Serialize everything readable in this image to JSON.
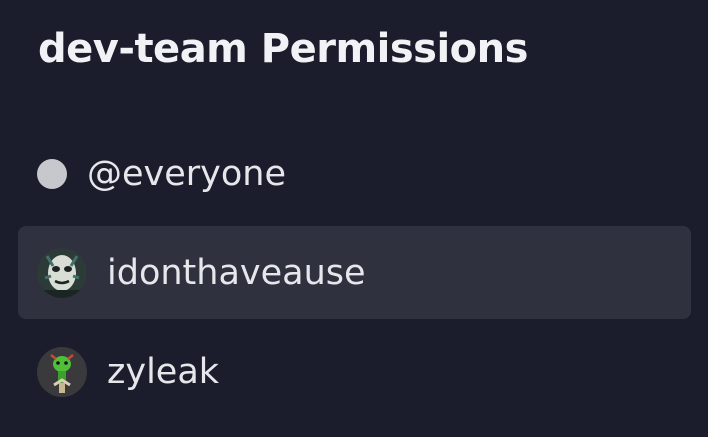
{
  "header": {
    "title": "dev-team Permissions"
  },
  "permissions": {
    "everyone": {
      "label": "@everyone"
    },
    "members": [
      {
        "name": "idonthaveause",
        "avatar": "masked-face-avatar",
        "selected": true
      },
      {
        "name": "zyleak",
        "avatar": "green-character-avatar",
        "selected": false
      }
    ]
  },
  "colors": {
    "background": "#1b1d2c",
    "selected_row": "#2f313f",
    "everyone_dot": "#c7c8cd",
    "text": "#e6e7eb"
  }
}
